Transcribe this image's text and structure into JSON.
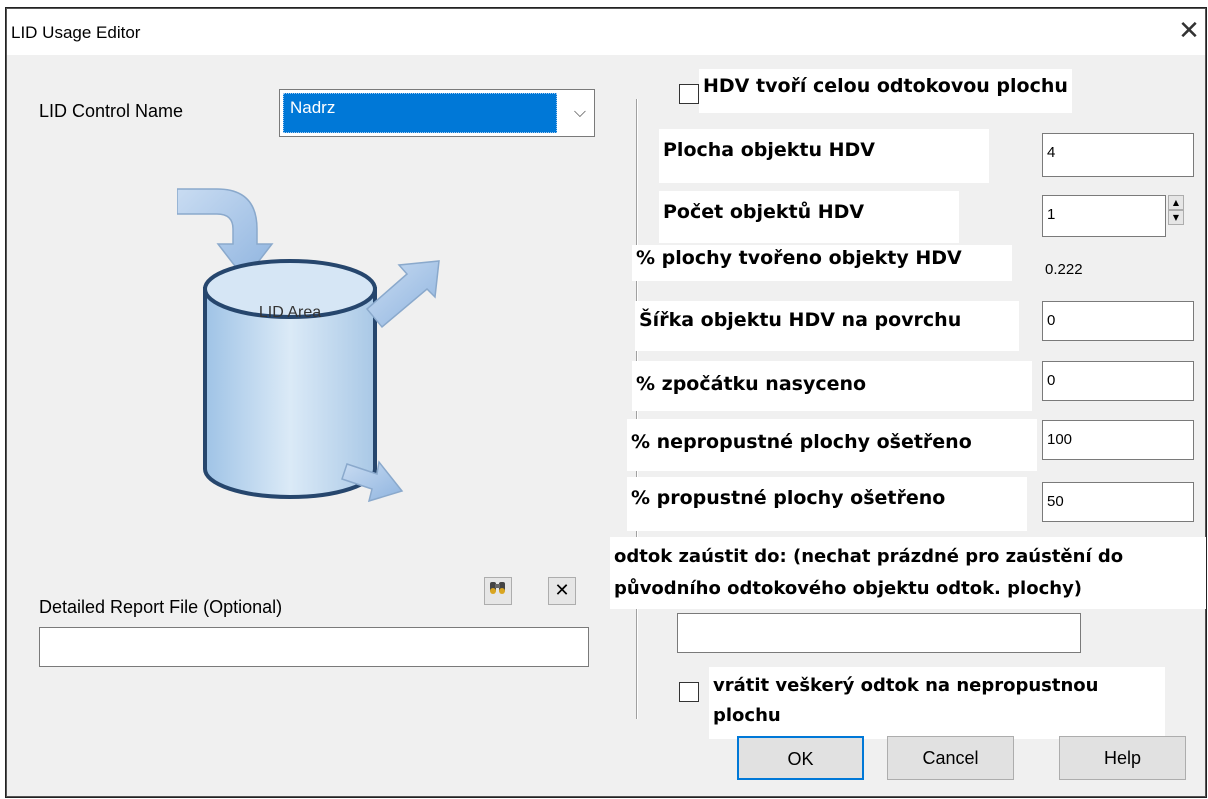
{
  "window": {
    "title": "LID Usage Editor",
    "close_glyph": "✕"
  },
  "left": {
    "lid_control_label": "LID Control Name",
    "lid_control_value": "Nadrz",
    "dropdown_glyph": "⌵",
    "illustration_label": "LID Area",
    "report_label": "Detailed Report File (Optional)",
    "report_value": "",
    "browse_icon": "binoculars-icon",
    "clear_glyph": "✕"
  },
  "right": {
    "whole_area_checkbox_label": "HDV tvoří celou odtokovou plochu",
    "whole_area_checked": false,
    "fields": [
      {
        "label": "Plocha objektu HDV",
        "value": "4"
      },
      {
        "label": "Počet objektů HDV",
        "value": "1"
      },
      {
        "label": "% plochy tvořeno objekty HDV",
        "value": "0.222"
      },
      {
        "label": "Šířka objektu HDV na povrchu",
        "value": "0"
      },
      {
        "label": "% zpočátku nasyceno",
        "value": "0"
      },
      {
        "label": "% nepropustné plochy ošetřeno",
        "value": "100"
      },
      {
        "label": "% propustné plochy ošetřeno",
        "value": "50"
      }
    ],
    "drain_to_label_line1": "odtok zaústit do: (nechat prázdné pro zaústění do",
    "drain_to_label_line2": "původního odtokového objektu odtok. plochy)",
    "drain_to_value": "",
    "return_checkbox_label_line1": "vrátit veškerý odtok na nepropustnou",
    "return_checkbox_label_line2": "plochu",
    "return_checked": false,
    "spin_up": "▲",
    "spin_down": "▼"
  },
  "buttons": {
    "ok": "OK",
    "cancel": "Cancel",
    "help": "Help"
  },
  "colors": {
    "selection": "#0078d7",
    "dialog_bg": "#f0f0f0"
  }
}
